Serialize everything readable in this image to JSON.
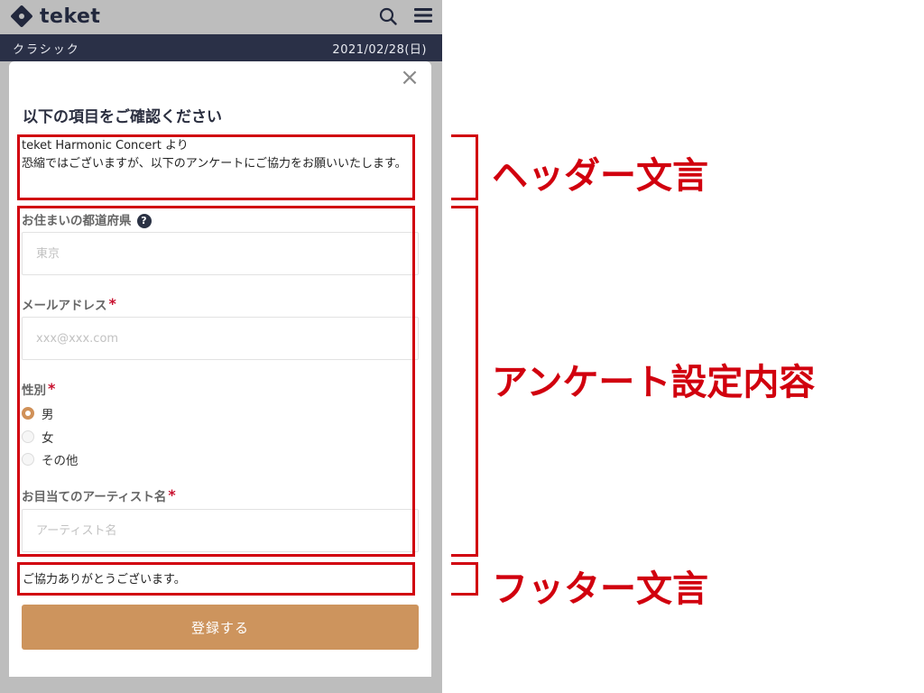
{
  "app": {
    "brand": "teket"
  },
  "category_bar": {
    "label": "クラシック",
    "date": "2021/02/28(日)"
  },
  "modal": {
    "close_symbol": "×",
    "title": "以下の項目をご確認ください",
    "header_text": {
      "line1": "teket Harmonic Concert より",
      "line2": "恐縮ではございますが、以下のアンケートにご協力をお願いいたします。"
    },
    "questions": {
      "prefecture": {
        "label": "お住まいの都道府県",
        "help_symbol": "?",
        "placeholder": "東京"
      },
      "email": {
        "label": "メールアドレス",
        "required_mark": "*",
        "placeholder": "xxx@xxx.com"
      },
      "gender": {
        "label": "性別",
        "required_mark": "*",
        "options": [
          "男",
          "女",
          "その他"
        ],
        "selected": "男"
      },
      "artist": {
        "label": "お目当てのアーティスト名",
        "required_mark": "*",
        "placeholder": "アーティスト名"
      }
    },
    "footer_text": "ご協力ありがとうございます。",
    "submit_label": "登録する"
  },
  "annotations": {
    "header": "ヘッダー文言",
    "survey": "アンケート設定内容",
    "footer": "フッター文言",
    "color": "#d1000e"
  },
  "colors": {
    "nav_bar": "#2a3047",
    "submit_button": "#cd945d",
    "backdrop": "#bdbdbd"
  }
}
